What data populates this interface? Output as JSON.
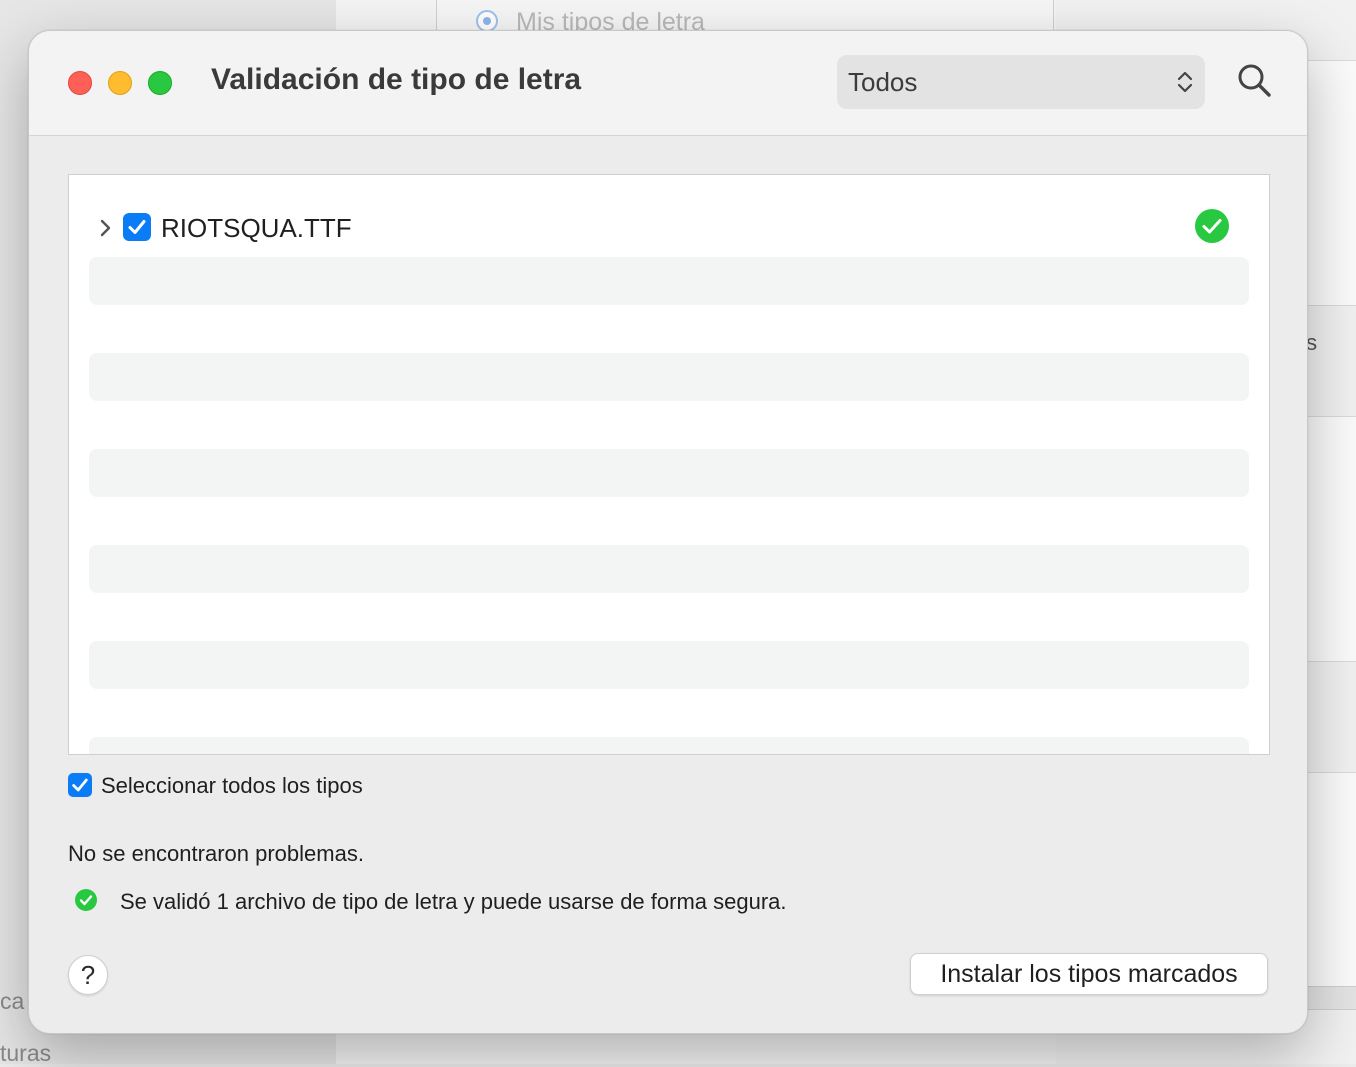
{
  "background": {
    "radio_label": "Mis tipos de letra",
    "right_partial_text": "ts",
    "left_partial_text_1": "ca",
    "left_partial_text_2": "turas"
  },
  "dialog": {
    "title": "Validación de tipo de letra",
    "filter": {
      "selected": "Todos"
    },
    "search_icon": "magnifying-glass",
    "list": {
      "rows": [
        {
          "name": "RIOTSQUA.TTF",
          "checked": true,
          "status": "ok"
        }
      ]
    },
    "select_all_label": "Seleccionar todos los tipos",
    "select_all_checked": true,
    "summary": "No se encontraron problemas.",
    "status_message": "Se validó 1 archivo de tipo de letra y puede usarse de forma segura.",
    "help_label": "?",
    "install_label": "Instalar los tipos marcados"
  },
  "colors": {
    "accent": "#0a7cf5",
    "ok_green": "#28c840",
    "close": "#fe5f57",
    "minimize": "#febc2e",
    "maximize": "#28c840"
  }
}
